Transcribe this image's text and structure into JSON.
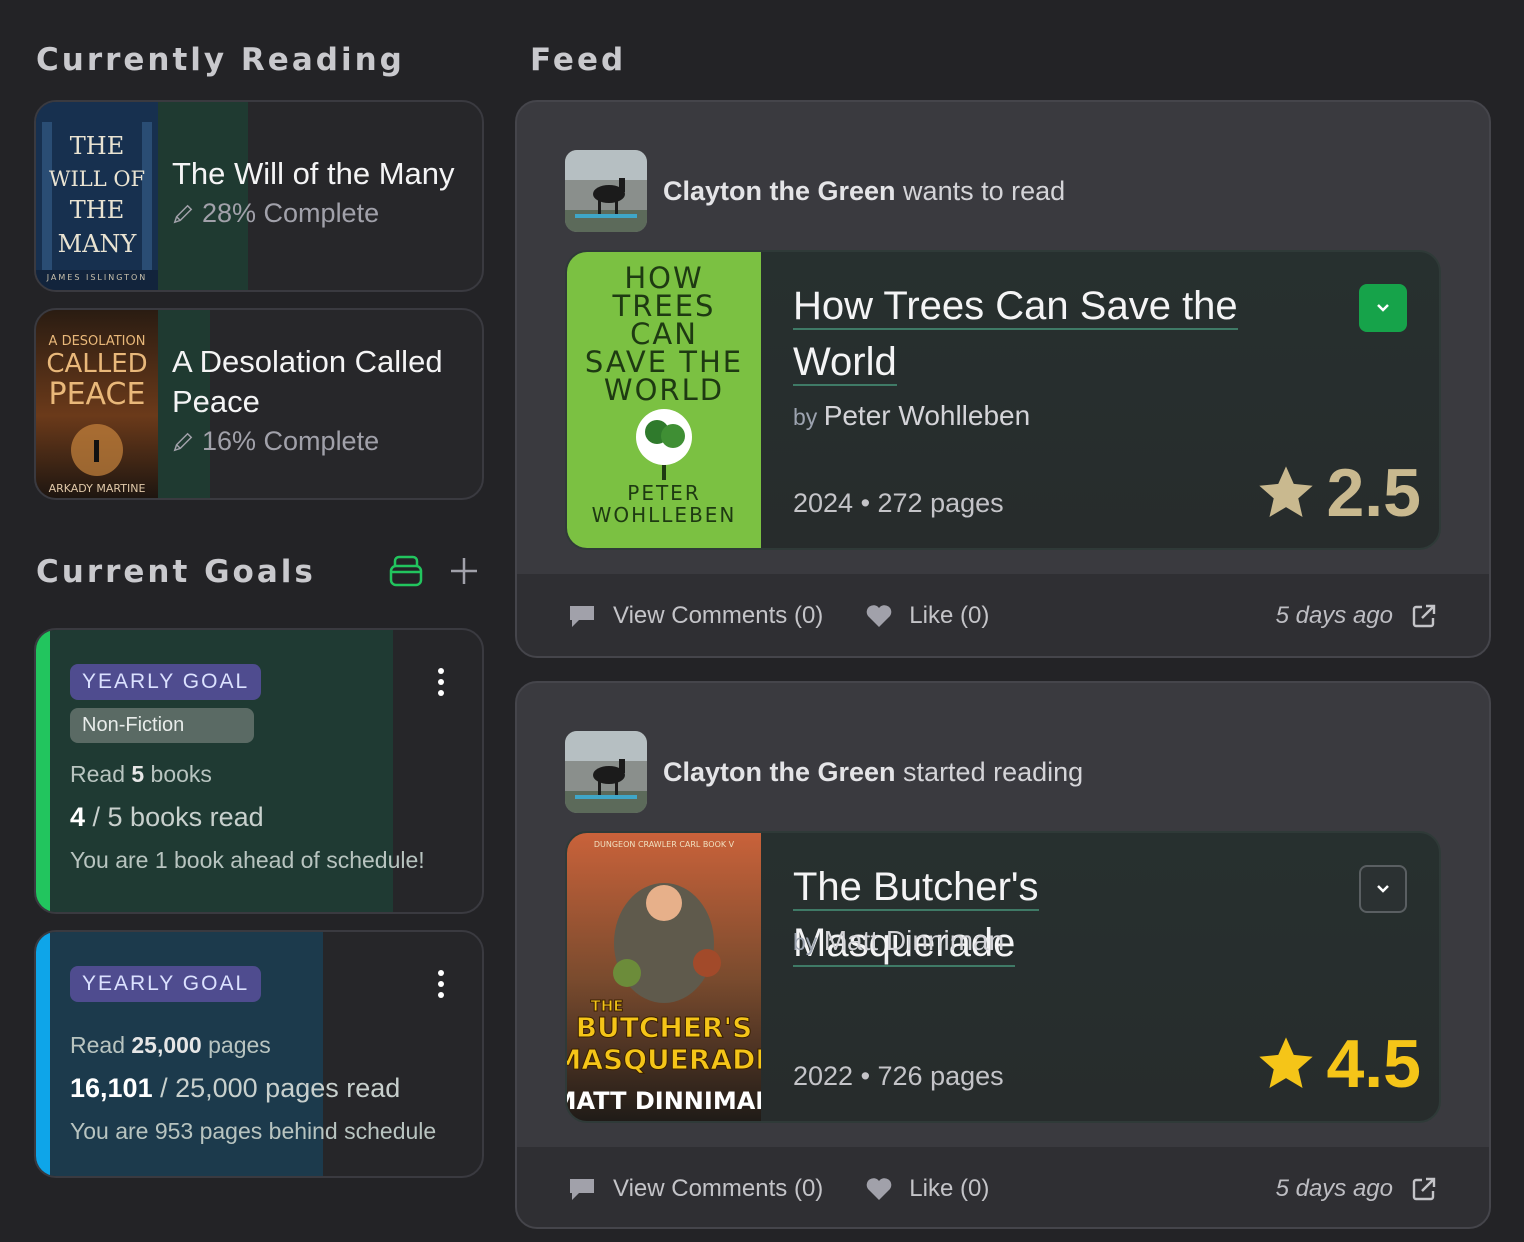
{
  "currently_reading": {
    "title": "Currently Reading",
    "books": [
      {
        "title": "The Will of the Many",
        "progress": "28% Complete",
        "cover_text": [
          "THE",
          "WILL OF",
          "THE",
          "MANY"
        ],
        "cover_author": "JAMES ISLINGTON"
      },
      {
        "title": "A Desolation Called Peace",
        "progress": "16% Complete",
        "cover_text": [
          "A DESOLATION",
          "CALLED",
          "PEACE"
        ],
        "cover_author": "ARKADY MARTINE"
      }
    ]
  },
  "goals": {
    "title": "Current Goals",
    "items": [
      {
        "badge": "YEARLY GOAL",
        "tag": "Non-Fiction",
        "read_prefix": "Read ",
        "read_target": "5",
        "read_suffix": " books",
        "count_done": "4",
        "count_rest": " / 5 books read",
        "status": "You are 1 book ahead of schedule!",
        "progress": 0.8,
        "accent": "#22c55e"
      },
      {
        "badge": "YEARLY GOAL",
        "read_prefix": "Read ",
        "read_target": "25,000",
        "read_suffix": " pages",
        "count_done": "16,101",
        "count_rest": " / 25,000 pages read",
        "status": "You are 953 pages behind schedule",
        "progress": 0.644,
        "accent": "#0ea5e9"
      }
    ]
  },
  "feed": {
    "title": "Feed",
    "posts": [
      {
        "user": "Clayton the Green",
        "action": " wants to read",
        "book_title": "How Trees Can Save the World",
        "by": "by ",
        "author": "Peter Wohlleben",
        "meta": "2024 • 272 pages",
        "rating": "2.5",
        "rating_color": "#c9b98f",
        "cover_lines": [
          "HOW",
          "TREES",
          "CAN",
          "SAVE THE",
          "WORLD"
        ],
        "cover_author": [
          "PETER",
          "WOHLLEBEN"
        ],
        "comments": "View Comments (0)",
        "like": "Like (0)",
        "time": "5 days ago"
      },
      {
        "user": "Clayton the Green",
        "action": " started reading",
        "book_title": "The Butcher's Masquerade",
        "by": "by ",
        "author": "Matt Dinniman",
        "meta": "2022 • 726 pages",
        "rating": "4.5",
        "rating_color": "#f5c518",
        "cover_top": "DUNGEON CRAWLER CARL BOOK V",
        "cover_lines": [
          "THE",
          "BUTCHER'S",
          "MASQUERADE"
        ],
        "cover_author": [
          "MATT DINNIMAN"
        ],
        "comments": "View Comments (0)",
        "like": "Like (0)",
        "time": "5 days ago"
      }
    ]
  }
}
